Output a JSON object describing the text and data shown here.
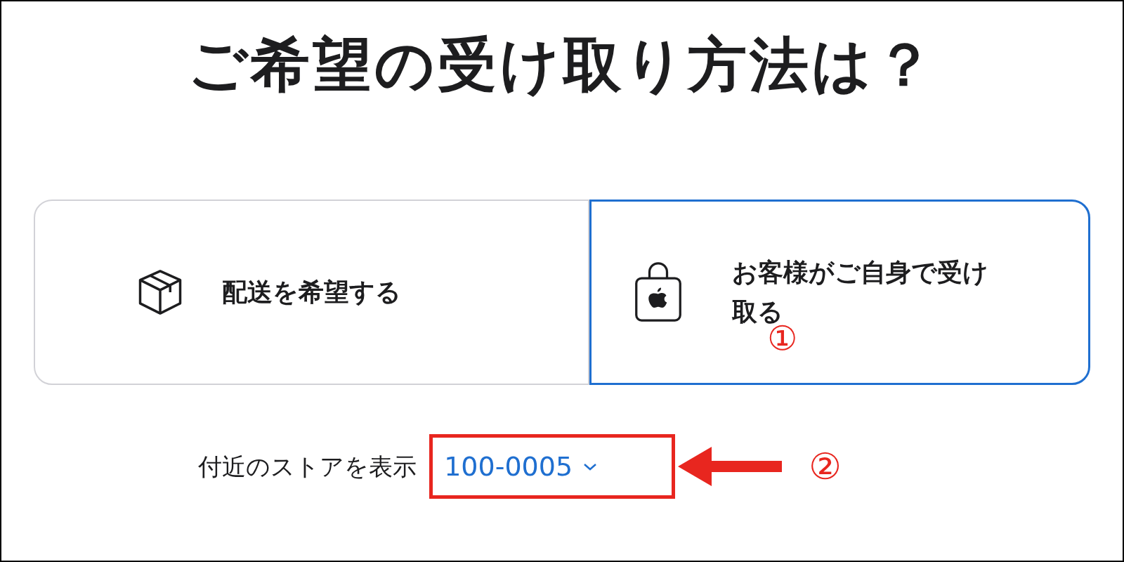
{
  "title": "ご希望の受け取り方法は？",
  "options": [
    {
      "kind": "delivery",
      "label": "配送を希望する",
      "selected": false
    },
    {
      "kind": "pickup",
      "label": "お客様がご自身で受け取る",
      "selected": true
    }
  ],
  "annotations": [
    "①",
    "②"
  ],
  "store": {
    "label": "付近のストアを表示",
    "postal_code": "100-0005"
  }
}
